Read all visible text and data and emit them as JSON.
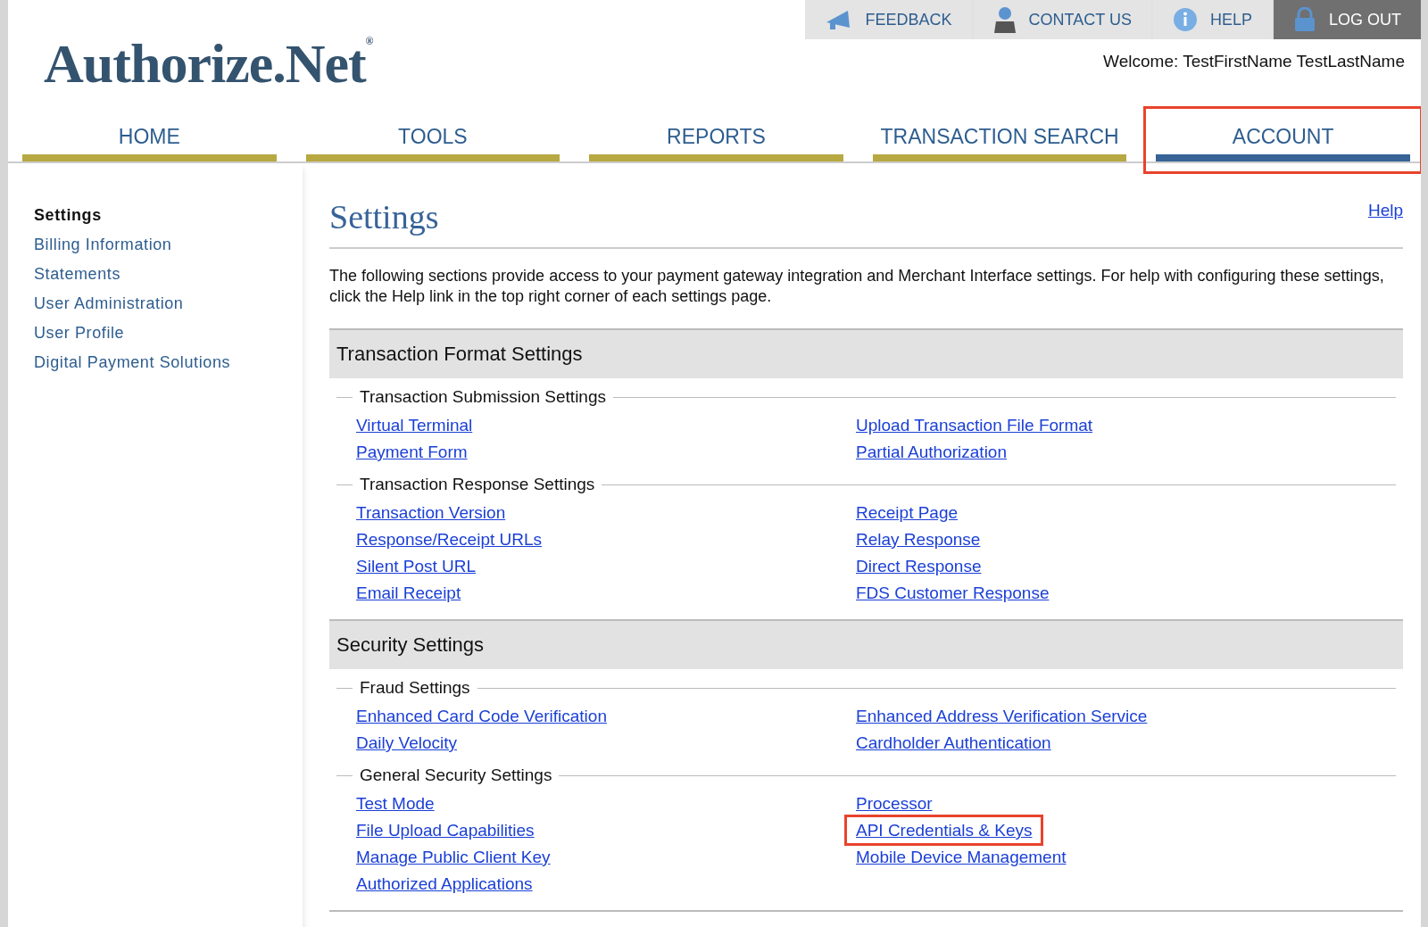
{
  "top_links": [
    {
      "label": "FEEDBACK",
      "kind": "megaphone",
      "selected": false
    },
    {
      "label": "CONTACT US",
      "kind": "person",
      "selected": false
    },
    {
      "label": "HELP",
      "kind": "info",
      "selected": false
    },
    {
      "label": "LOG OUT",
      "kind": "lock",
      "selected": true
    }
  ],
  "logo": "Authorize.Net",
  "logo_mark": "®",
  "welcome": "Welcome: TestFirstName TestLastName",
  "nav": [
    {
      "label": "HOME",
      "selected": false,
      "highlighted": false
    },
    {
      "label": "TOOLS",
      "selected": false,
      "highlighted": false
    },
    {
      "label": "REPORTS",
      "selected": false,
      "highlighted": false
    },
    {
      "label": "TRANSACTION SEARCH",
      "selected": false,
      "highlighted": false
    },
    {
      "label": "ACCOUNT",
      "selected": true,
      "highlighted": true
    }
  ],
  "sidebar": {
    "items": [
      {
        "label": "Settings",
        "selected": true
      },
      {
        "label": "Billing Information",
        "selected": false
      },
      {
        "label": "Statements",
        "selected": false
      },
      {
        "label": "User Administration",
        "selected": false
      },
      {
        "label": "User Profile",
        "selected": false
      },
      {
        "label": "Digital Payment Solutions",
        "selected": false
      }
    ]
  },
  "page_title": "Settings",
  "help_link": "Help",
  "intro": "The following sections provide access to your payment gateway integration and Merchant Interface settings. For help with configuring these settings, click the Help link in the top right corner of each settings page.",
  "sections": [
    {
      "title": "Transaction Format Settings",
      "groups": [
        {
          "title": "Transaction Submission Settings",
          "left": [
            {
              "label": "Virtual Terminal",
              "highlighted": false
            },
            {
              "label": "Payment Form",
              "highlighted": false
            }
          ],
          "right": [
            {
              "label": "Upload Transaction File Format",
              "highlighted": false
            },
            {
              "label": "Partial Authorization",
              "highlighted": false
            }
          ]
        },
        {
          "title": "Transaction Response Settings",
          "left": [
            {
              "label": "Transaction Version",
              "highlighted": false
            },
            {
              "label": "Response/Receipt URLs",
              "highlighted": false
            },
            {
              "label": "Silent Post URL",
              "highlighted": false
            },
            {
              "label": "Email Receipt",
              "highlighted": false
            }
          ],
          "right": [
            {
              "label": "Receipt Page",
              "highlighted": false
            },
            {
              "label": "Relay Response",
              "highlighted": false
            },
            {
              "label": "Direct Response",
              "highlighted": false
            },
            {
              "label": "FDS Customer Response",
              "highlighted": false
            }
          ]
        }
      ]
    },
    {
      "title": "Security Settings",
      "groups": [
        {
          "title": "Fraud Settings",
          "left": [
            {
              "label": "Enhanced Card Code Verification",
              "highlighted": false
            },
            {
              "label": "Daily Velocity",
              "highlighted": false
            }
          ],
          "right": [
            {
              "label": "Enhanced Address Verification Service",
              "highlighted": false
            },
            {
              "label": "Cardholder Authentication",
              "highlighted": false
            }
          ]
        },
        {
          "title": "General Security Settings",
          "left": [
            {
              "label": "Test Mode",
              "highlighted": false
            },
            {
              "label": "File Upload Capabilities",
              "highlighted": false
            },
            {
              "label": "Manage Public Client Key",
              "highlighted": false
            },
            {
              "label": "Authorized Applications",
              "highlighted": false
            }
          ],
          "right": [
            {
              "label": "Processor",
              "highlighted": false
            },
            {
              "label": "API Credentials & Keys",
              "highlighted": true
            },
            {
              "label": "Mobile Device Management",
              "highlighted": false
            }
          ]
        }
      ]
    }
  ]
}
